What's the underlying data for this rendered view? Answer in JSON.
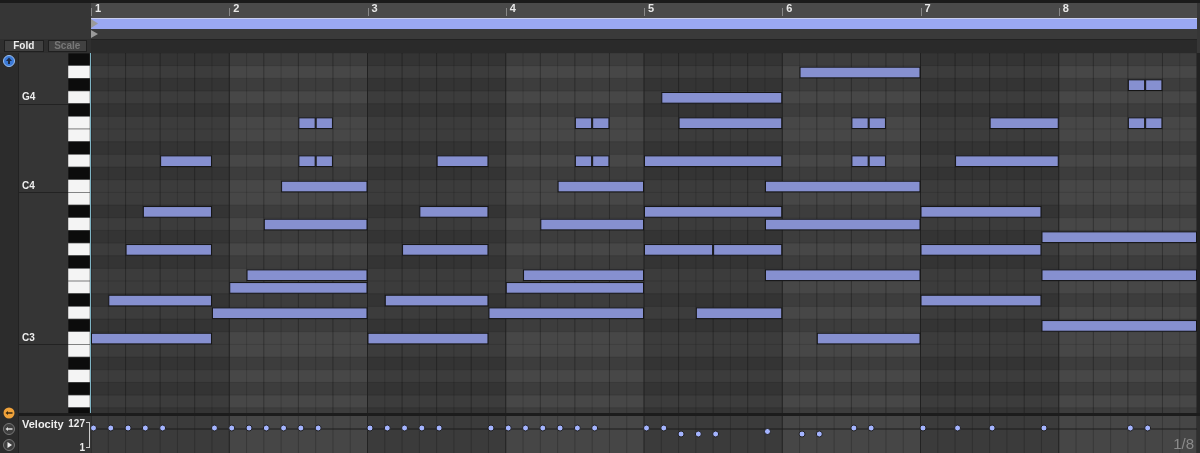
{
  "ruler": {
    "bars": [
      "1",
      "2",
      "3",
      "4",
      "5",
      "6",
      "7",
      "8"
    ]
  },
  "buttons": [
    {
      "label": "Fold",
      "disabled": false
    },
    {
      "label": "Scale",
      "disabled": true
    }
  ],
  "key_labels": [
    "G4",
    "C4",
    "C3"
  ],
  "velocity_lane": {
    "title": "Velocity",
    "max": "127",
    "min": "1"
  },
  "grid": "1/8"
}
